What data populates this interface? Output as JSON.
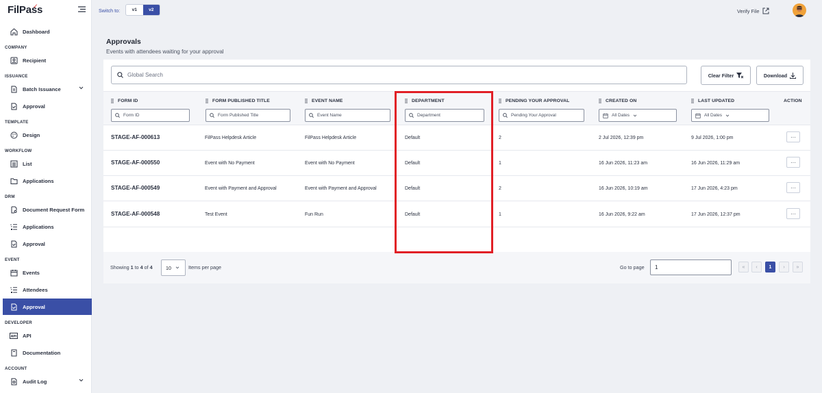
{
  "brand": {
    "name": "FilPass"
  },
  "topbar": {
    "switch_label": "Switch to:",
    "versions": [
      "v1",
      "v2"
    ],
    "active_version": "v2",
    "verify_label": "Verify File"
  },
  "sidebar": {
    "dashboard": "Dashboard",
    "sections": {
      "company": "COMPANY",
      "issuance": "ISSUANCE",
      "template": "TEMPLATE",
      "workflow": "WORKFLOW",
      "drm": "DRM",
      "event": "EVENT",
      "developer": "DEVELOPER",
      "account": "ACCOUNT"
    },
    "items": {
      "recipient": "Recipient",
      "batch_issuance": "Batch Issuance",
      "issuance_approval": "Approval",
      "design": "Design",
      "list": "List",
      "workflow_applications": "Applications",
      "document_request_form": "Document Request Form",
      "drm_applications": "Applications",
      "drm_approval": "Approval",
      "events": "Events",
      "attendees": "Attendees",
      "event_approval": "Approval",
      "api": "API",
      "documentation": "Documentation",
      "audit_log": "Audit Log"
    }
  },
  "page": {
    "title": "Approvals",
    "subtitle": "Events with attendees waiting for your approval"
  },
  "toolbar": {
    "search_placeholder": "Global Search",
    "clear_filter": "Clear Filter",
    "download": "Download"
  },
  "table": {
    "columns": {
      "form_id": "FORM ID",
      "form_title": "FORM PUBLISHED TITLE",
      "event_name": "EVENT NAME",
      "department": "DEPARTMENT",
      "pending": "PENDING YOUR APPROVAL",
      "created": "CREATED ON",
      "updated": "LAST UPDATED",
      "action": "ACTION"
    },
    "filters": {
      "form_id": "Form ID",
      "form_title": "Form Published Title",
      "event_name": "Event Name",
      "department": "Department",
      "pending": "Pending Your Approval",
      "created": "All Dates",
      "updated": "All Dates"
    },
    "rows": [
      {
        "form_id": "STAGE-AF-000613",
        "form_title": "FilPass Helpdesk Article",
        "event_name": "FilPass Helpdesk Article",
        "department": "Default",
        "pending": "2",
        "created": "2 Jul 2026, 12:39 pm",
        "updated": "9 Jul 2026, 1:00 pm",
        "action": "···"
      },
      {
        "form_id": "STAGE-AF-000550",
        "form_title": "Event with No Payment",
        "event_name": "Event with No Payment",
        "department": "Default",
        "pending": "1",
        "created": "16 Jun 2026, 11:23 am",
        "updated": "16 Jun 2026, 11:29 am",
        "action": "···"
      },
      {
        "form_id": "STAGE-AF-000549",
        "form_title": "Event with Payment and Approval",
        "event_name": "Event with Payment and Approval",
        "department": "Default",
        "pending": "2",
        "created": "16 Jun 2026, 10:19 am",
        "updated": "17 Jun 2026, 4:23 pm",
        "action": "···"
      },
      {
        "form_id": "STAGE-AF-000548",
        "form_title": "Test Event",
        "event_name": "Fun Run",
        "department": "Default",
        "pending": "1",
        "created": "16 Jun 2026, 9:22 am",
        "updated": "17 Jun 2026, 12:37 pm",
        "action": "···"
      }
    ]
  },
  "pagination": {
    "showing_prefix": "Showing",
    "from": "1",
    "to_word": "to",
    "to": "4",
    "of_word": "of",
    "total": "4",
    "per_page": "10",
    "items_per_page": "Items per page",
    "go_to_page": "Go to page",
    "page_input": "1",
    "first": "«",
    "prev": "‹",
    "current": "1",
    "next": "›",
    "last": "»"
  },
  "colors": {
    "accent": "#3a4fa6",
    "highlight": "#e11f26"
  }
}
